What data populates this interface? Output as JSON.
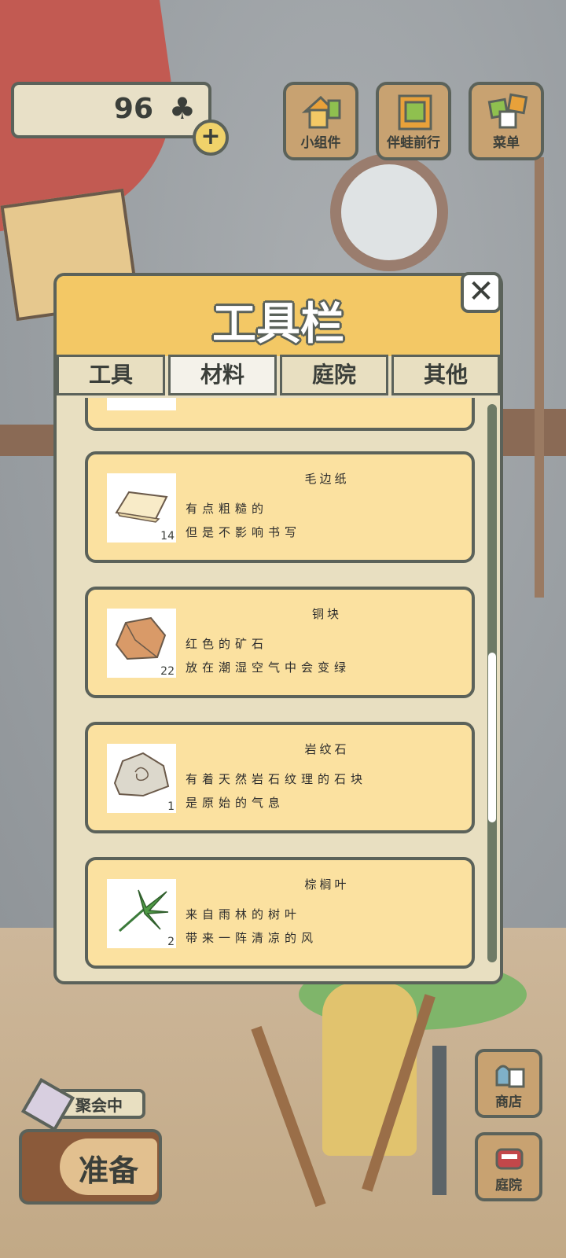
{
  "hud": {
    "clover_count": "96",
    "clover_symbol": "♣",
    "plus_symbol": "+",
    "buttons": [
      {
        "label": "小组件",
        "icon": "widget-house-icon"
      },
      {
        "label": "伴蛙前行",
        "icon": "notebook-icon"
      },
      {
        "label": "菜单",
        "icon": "menu-cards-icon"
      }
    ]
  },
  "toolbar": {
    "title": "工具栏",
    "close_symbol": "✕",
    "tabs": [
      {
        "label": "工具",
        "active": false
      },
      {
        "label": "材料",
        "active": true
      },
      {
        "label": "庭院",
        "active": false
      },
      {
        "label": "其他",
        "active": false
      }
    ],
    "items": [
      {
        "name": "毛边纸",
        "quantity": "14",
        "desc1": "有点粗糙的",
        "desc2": "但是不影响书写",
        "icon": "paper-sheet-icon"
      },
      {
        "name": "铜块",
        "quantity": "22",
        "desc1": "红色的矿石",
        "desc2": "放在潮湿空气中会变绿",
        "icon": "copper-ore-icon"
      },
      {
        "name": "岩纹石",
        "quantity": "1",
        "desc1": "有着天然岩石纹理的石块",
        "desc2": "是原始的气息",
        "icon": "patterned-stone-icon"
      },
      {
        "name": "棕榈叶",
        "quantity": "2",
        "desc1": "来自雨林的树叶",
        "desc2": "带来一阵清凉的风",
        "icon": "palm-leaf-icon"
      }
    ]
  },
  "bottom_left": {
    "party_label": "聚会中",
    "prepare_label": "准备"
  },
  "bottom_right": {
    "shop_label": "商店",
    "yard_label": "庭院"
  },
  "colors": {
    "outline": "#5b625a",
    "header_yellow": "#f3c865",
    "item_bg": "#fbe1a0",
    "panel_bg": "#e8dfc1"
  }
}
